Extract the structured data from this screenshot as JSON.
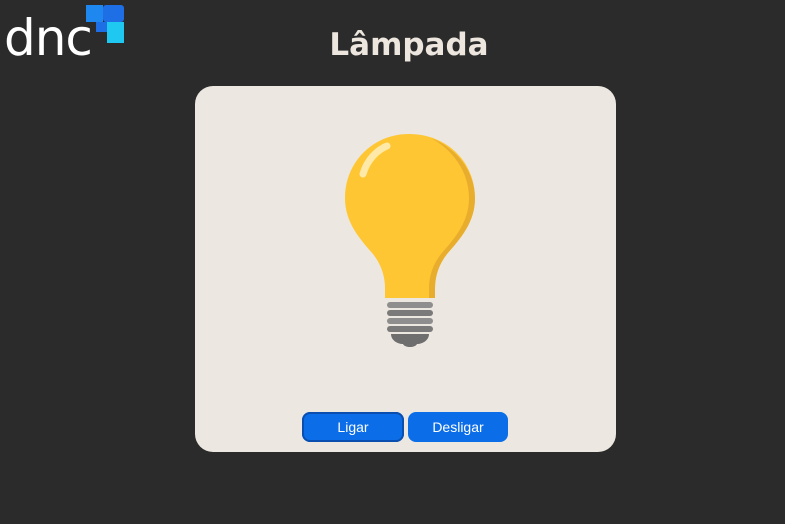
{
  "logo": {
    "text": "dnc",
    "icon": "dnc-squares-logo",
    "colors": {
      "dark_blue": "#1e6fe6",
      "light_blue": "#1ec8f0"
    }
  },
  "page": {
    "title": "Lâmpada"
  },
  "lamp": {
    "state": "on",
    "icon": "lightbulb-icon",
    "bulb_color": "#fec632"
  },
  "controls": {
    "on_label": "Ligar",
    "off_label": "Desligar",
    "button_color": "#0b6ee8"
  },
  "colors": {
    "background": "#2b2b2b",
    "card": "#ece7e0",
    "title": "#ece6de"
  }
}
